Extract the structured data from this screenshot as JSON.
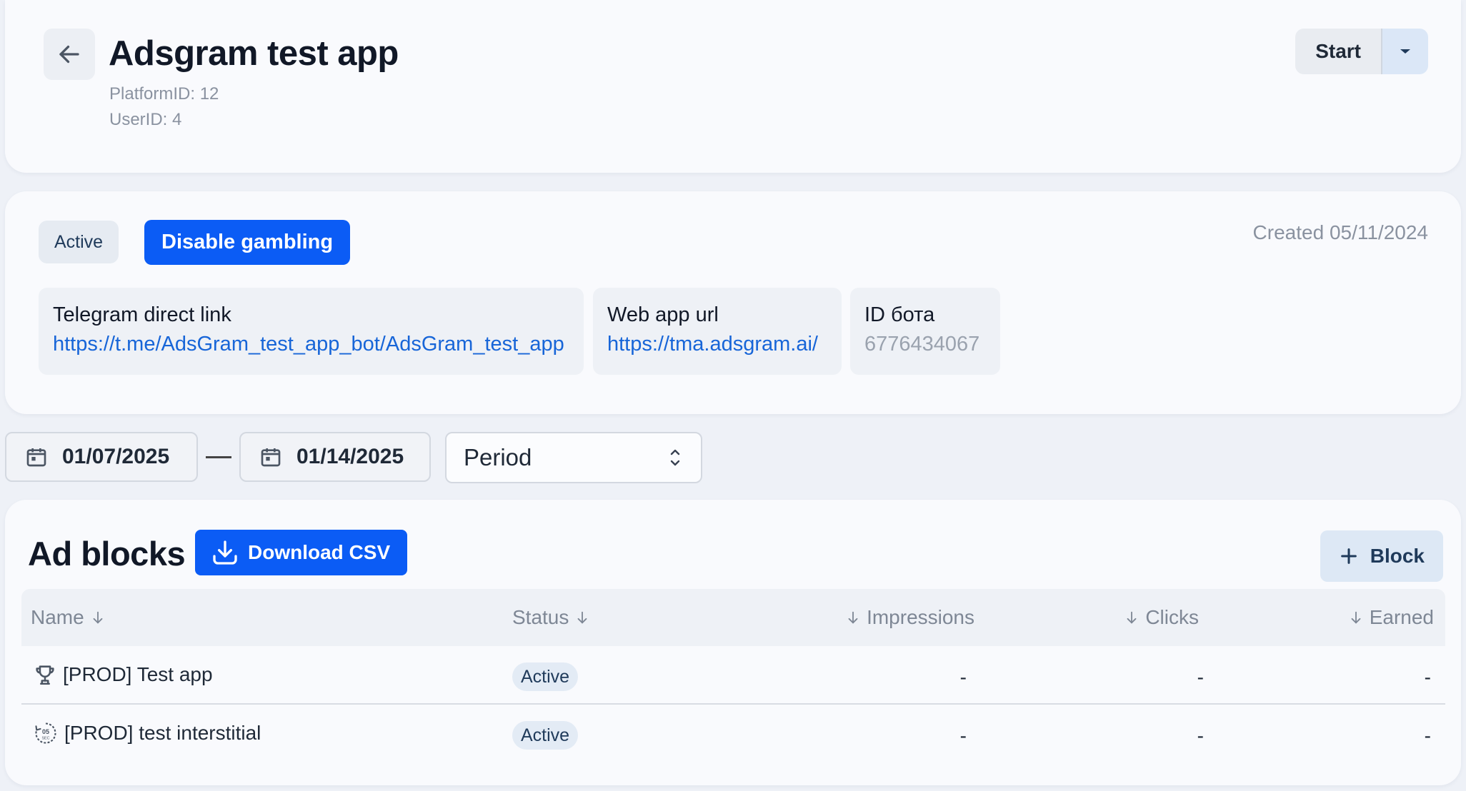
{
  "header": {
    "title": "Adsgram test app",
    "platform_id": "PlatformID: 12",
    "user_id": "UserID: 4",
    "start_label": "Start"
  },
  "info": {
    "status": "Active",
    "gambling_button": "Disable gambling",
    "created": "Created 05/11/2024",
    "fields": [
      {
        "label": "Telegram direct link",
        "value": "https://t.me/AdsGram_test_app_bot/AdsGram_test_app"
      },
      {
        "label": "Web app url",
        "value": "https://tma.adsgram.ai/"
      },
      {
        "label": "ID бота",
        "value": "6776434067"
      }
    ]
  },
  "filters": {
    "date_from": "01/07/2025",
    "date_to": "01/14/2025",
    "period": "Period"
  },
  "ad_blocks": {
    "title": "Ad blocks",
    "download_label": "Download CSV",
    "add_block_label": "Block",
    "columns": [
      "Name",
      "Status",
      "Impressions",
      "Clicks",
      "Earned"
    ],
    "rows": [
      {
        "icon": "trophy-icon",
        "name": "[PROD] Test app",
        "status": "Active",
        "impressions": "-",
        "clicks": "-",
        "earned": "-"
      },
      {
        "icon": "timer-05-sec-icon",
        "name": "[PROD] test interstitial",
        "status": "Active",
        "impressions": "-",
        "clicks": "-",
        "earned": "-"
      }
    ]
  },
  "colors": {
    "accent": "#0b5cf5",
    "link": "#1765d8",
    "background": "#eef1f7",
    "card": "#f9fafd"
  }
}
